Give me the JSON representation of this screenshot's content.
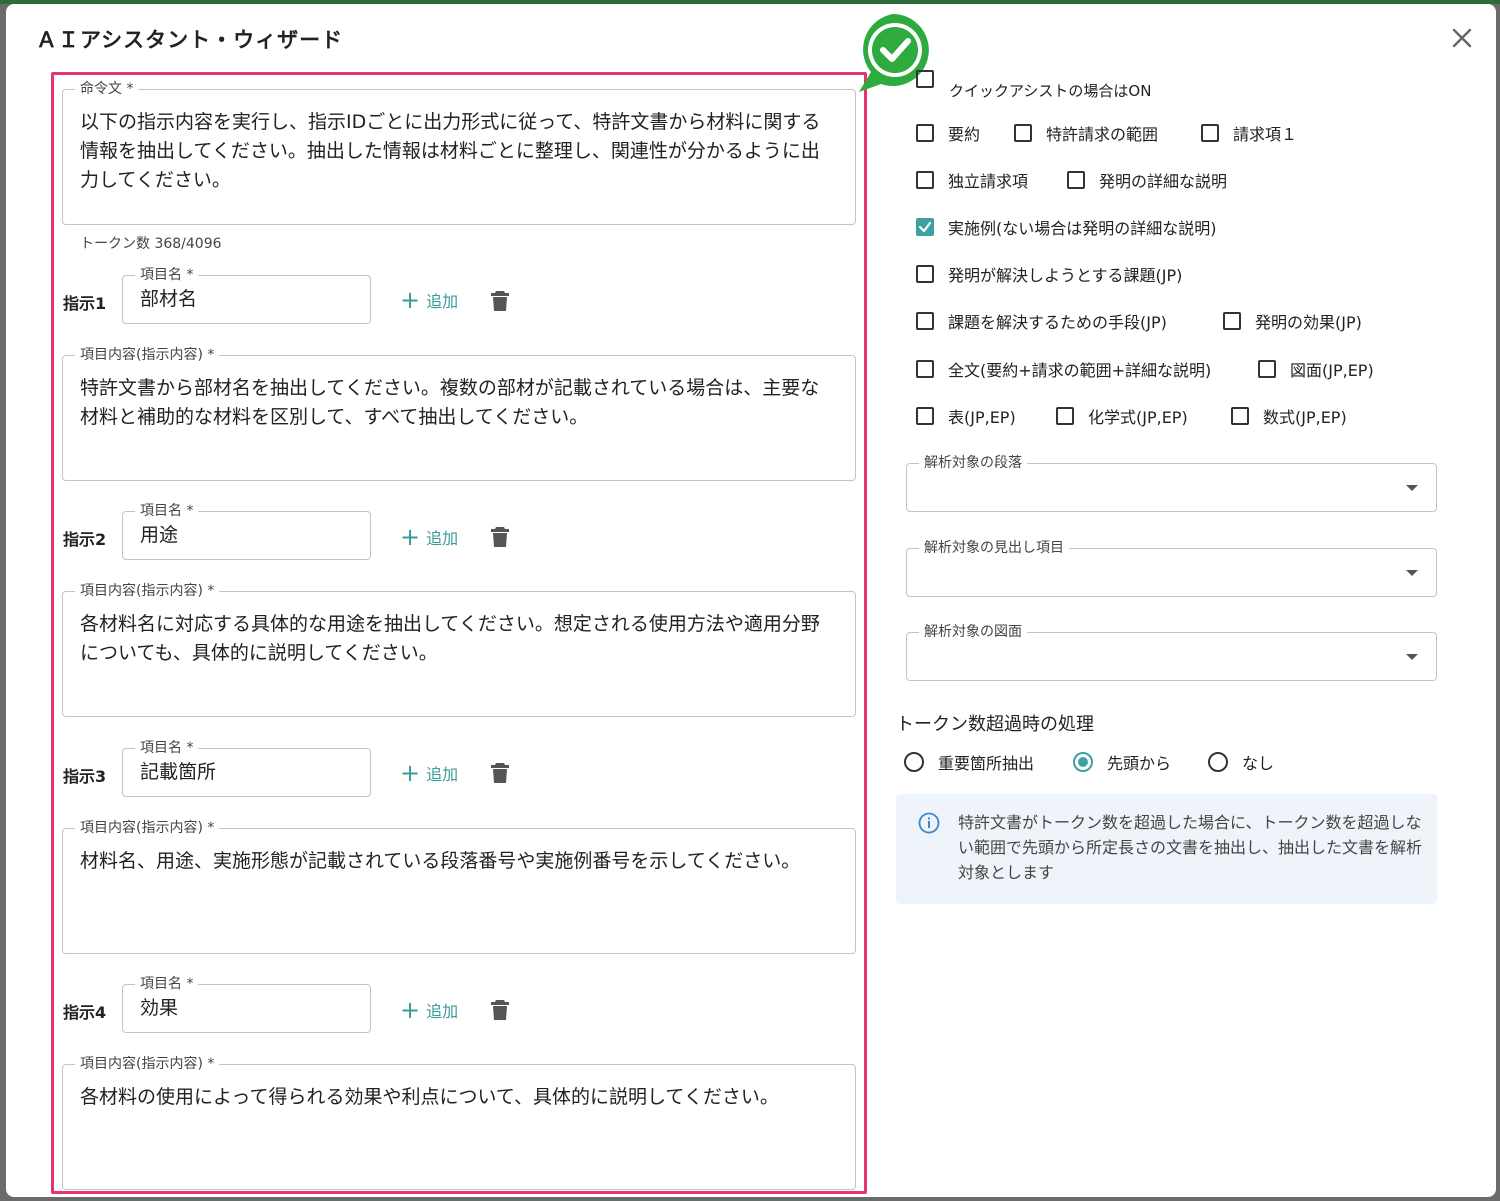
{
  "dialog": {
    "title": "ＡＩアシスタント・ウィザード",
    "close_icon": "close-icon"
  },
  "prompt": {
    "label": "命令文 *",
    "value": "以下の指示内容を実行し、指示IDごとに出力形式に従って、特許文書から材料に関する情報を抽出してください。抽出した情報は材料ごとに整理し、関連性が分かるように出力してください。",
    "token_count": "トークン数 368/4096"
  },
  "instructions": [
    {
      "id_label": "指示1",
      "name_label": "項目名 *",
      "name_value": "部材名",
      "add_label": "追加",
      "content_label": "項目内容(指示内容) *",
      "content_value": "特許文書から部材名を抽出してください。複数の部材が記載されている場合は、主要な材料と補助的な材料を区別して、すべて抽出してください。"
    },
    {
      "id_label": "指示2",
      "name_label": "項目名 *",
      "name_value": "用途",
      "add_label": "追加",
      "content_label": "項目内容(指示内容) *",
      "content_value": "各材料名に対応する具体的な用途を抽出してください。想定される使用方法や適用分野についても、具体的に説明してください。"
    },
    {
      "id_label": "指示3",
      "name_label": "項目名 *",
      "name_value": "記載箇所",
      "add_label": "追加",
      "content_label": "項目内容(指示内容) *",
      "content_value": "材料名、用途、実施形態が記載されている段落番号や実施例番号を示してください。"
    },
    {
      "id_label": "指示4",
      "name_label": "項目名 *",
      "name_value": "効果",
      "add_label": "追加",
      "content_label": "項目内容(指示内容) *",
      "content_value": "各材料の使用によって得られる効果や利点について、具体的に説明してください。"
    }
  ],
  "targets": {
    "quick_assist_label": "クイックアシストの場合はON",
    "options": [
      {
        "label": "要約",
        "checked": false
      },
      {
        "label": "特許請求の範囲",
        "checked": false
      },
      {
        "label": "請求項１",
        "checked": false
      },
      {
        "label": "独立請求項",
        "checked": false
      },
      {
        "label": "発明の詳細な説明",
        "checked": false
      },
      {
        "label": "実施例(ない場合は発明の詳細な説明)",
        "checked": true
      },
      {
        "label": "発明が解決しようとする課題(JP)",
        "checked": false
      },
      {
        "label": "課題を解決するための手段(JP)",
        "checked": false
      },
      {
        "label": "発明の効果(JP)",
        "checked": false
      },
      {
        "label": "全文(要約+請求の範囲+詳細な説明)",
        "checked": false
      },
      {
        "label": "図面(JP,EP)",
        "checked": false
      },
      {
        "label": "表(JP,EP)",
        "checked": false
      },
      {
        "label": "化学式(JP,EP)",
        "checked": false
      },
      {
        "label": "数式(JP,EP)",
        "checked": false
      }
    ]
  },
  "selects": {
    "paragraph_label": "解析対象の段落",
    "heading_label": "解析対象の見出し項目",
    "figure_label": "解析対象の図面"
  },
  "overflow": {
    "title": "トークン数超過時の処理",
    "options": [
      {
        "label": "重要箇所抽出",
        "checked": false
      },
      {
        "label": "先頭から",
        "checked": true
      },
      {
        "label": "なし",
        "checked": false
      }
    ],
    "info_text": "特許文書がトークン数を超過した場合に、トークン数を超過しない範囲で先頭から所定長さの文書を抽出し、抽出した文書を解析対象とします"
  },
  "colors": {
    "accent": "#40a0a0",
    "highlight": "#e8336d",
    "badge": "#2eaa3e"
  }
}
